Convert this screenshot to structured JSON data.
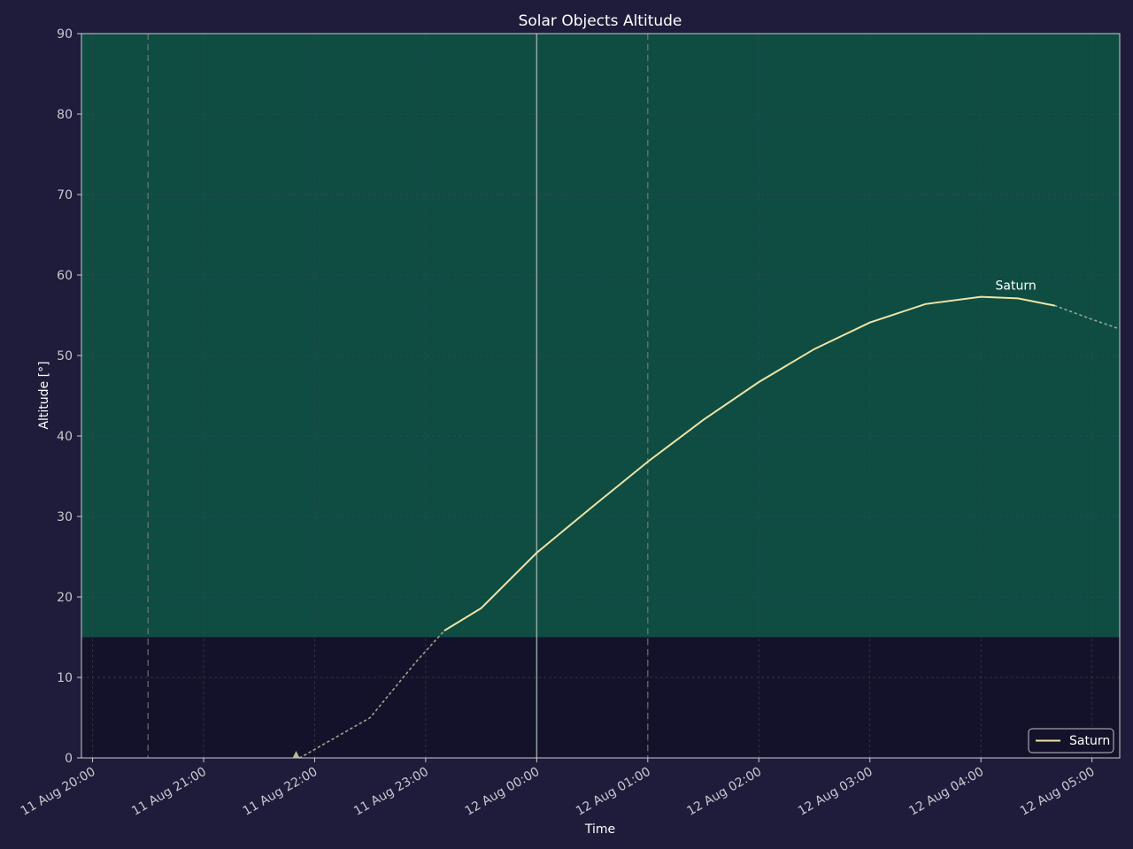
{
  "chart_data": {
    "type": "line",
    "title": "Solar Objects Altitude",
    "xlabel": "Time",
    "ylabel": "Altitude [°]",
    "xlim": [
      "2024-08-11T19:54",
      "2024-08-12T05:15"
    ],
    "ylim": [
      0,
      90
    ],
    "x_ticks": [
      {
        "t": "2024-08-11T20:00",
        "label": "11 Aug 20:00"
      },
      {
        "t": "2024-08-11T21:00",
        "label": "11 Aug 21:00"
      },
      {
        "t": "2024-08-11T22:00",
        "label": "11 Aug 22:00"
      },
      {
        "t": "2024-08-11T23:00",
        "label": "11 Aug 23:00"
      },
      {
        "t": "2024-08-12T00:00",
        "label": "12 Aug 00:00"
      },
      {
        "t": "2024-08-12T01:00",
        "label": "12 Aug 01:00"
      },
      {
        "t": "2024-08-12T02:00",
        "label": "12 Aug 02:00"
      },
      {
        "t": "2024-08-12T03:00",
        "label": "12 Aug 03:00"
      },
      {
        "t": "2024-08-12T04:00",
        "label": "12 Aug 04:00"
      },
      {
        "t": "2024-08-12T05:00",
        "label": "12 Aug 05:00"
      }
    ],
    "y_ticks": [
      0,
      10,
      20,
      30,
      40,
      50,
      60,
      70,
      80,
      90
    ],
    "grid": true,
    "legend": {
      "position": "bottom-right",
      "entries": [
        "Saturn"
      ]
    },
    "altitude_limit": 15,
    "visible_band": [
      15,
      90
    ],
    "vertical_markers": {
      "dashed": [
        "2024-08-11T20:30",
        "2024-08-12T01:00"
      ],
      "solid": [
        "2024-08-12T00:00"
      ]
    },
    "series": [
      {
        "name": "Saturn",
        "color": "#ede4a6",
        "rise_marker": {
          "t": "2024-08-11T21:50",
          "alt": 0
        },
        "peak_label": {
          "text": "Saturn",
          "t": "2024-08-12T04:04",
          "alt": 57.3
        },
        "dotted_segments": [
          [
            [
              "2024-08-11T21:52",
              0
            ],
            [
              "2024-08-11T22:30",
              5
            ],
            [
              "2024-08-11T22:55",
              12
            ],
            [
              "2024-08-11T23:10",
              15.8
            ]
          ],
          [
            [
              "2024-08-12T04:40",
              56.2
            ],
            [
              "2024-08-12T05:00",
              54.5
            ],
            [
              "2024-08-12T05:15",
              53.3
            ]
          ]
        ],
        "solid_segment": [
          [
            "2024-08-11T23:10",
            15.8
          ],
          [
            "2024-08-11T23:30",
            18.6
          ],
          [
            "2024-08-12T00:00",
            25.5
          ],
          [
            "2024-08-12T00:30",
            31.2
          ],
          [
            "2024-08-12T01:00",
            36.8
          ],
          [
            "2024-08-12T01:30",
            42.0
          ],
          [
            "2024-08-12T02:00",
            46.7
          ],
          [
            "2024-08-12T02:30",
            50.8
          ],
          [
            "2024-08-12T03:00",
            54.1
          ],
          [
            "2024-08-12T03:30",
            56.4
          ],
          [
            "2024-08-12T04:00",
            57.3
          ],
          [
            "2024-08-12T04:20",
            57.1
          ],
          [
            "2024-08-12T04:40",
            56.2
          ]
        ]
      }
    ],
    "colors": {
      "background": "#1e1c3a",
      "plot_background": "#14122a",
      "visible_band": "#0f4c41",
      "axes": "#c8ccd0",
      "text": "#ffffff",
      "tick_text": "#c8c8d0",
      "grid": "#3a4a58",
      "marker_line": "#8a8a8a",
      "now_line": "#a8b8b0"
    }
  }
}
